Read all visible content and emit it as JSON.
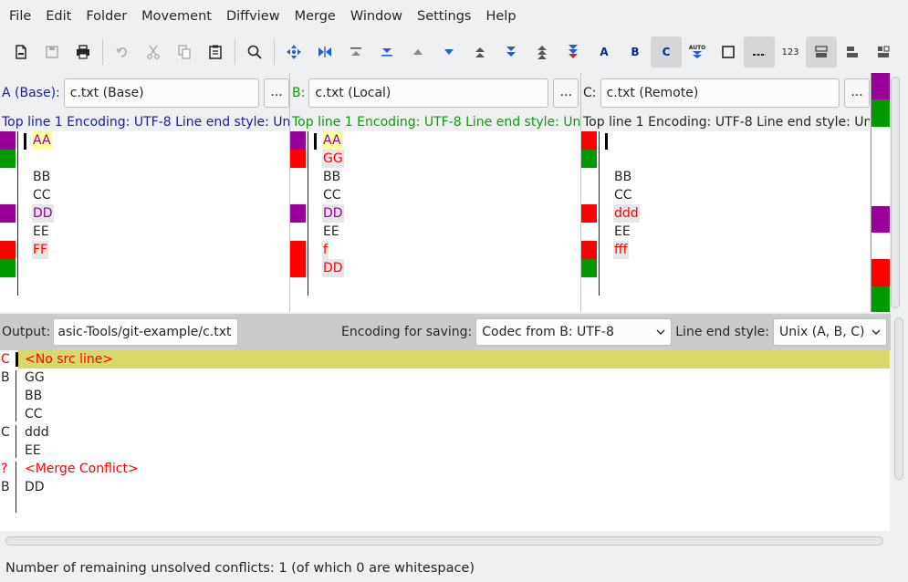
{
  "colors": {
    "base_label": "#1a1aa6",
    "local_label": "#0e9a0e",
    "remote_label": "#232627",
    "changed_purple": "#990099",
    "changed_red": "#ff0000",
    "added_green": "#009900",
    "merge_highlight": "#d9d96a"
  },
  "menu": [
    "File",
    "Edit",
    "Folder",
    "Movement",
    "Diffview",
    "Merge",
    "Window",
    "Settings",
    "Help"
  ],
  "toolbar": {
    "buttons": [
      "new-file",
      "save",
      "print",
      "undo",
      "cut",
      "copy",
      "paste",
      "find",
      "go-current",
      "go-top",
      "go-prev-delta",
      "go-bottom",
      "go-prev",
      "go-next",
      "go-prev-conflict",
      "go-next-conflict",
      "go-first-unsolved",
      "go-last-unsolved",
      "select-a",
      "select-b",
      "select-c",
      "auto-advance",
      "show-whitespace",
      "show-space-chars",
      "line-numbers",
      "split-view-1",
      "split-view-2",
      "split-view-3"
    ],
    "auto_label": "AUTO",
    "a_label": "A",
    "b_label": "B",
    "c_label": "C",
    "numbers_label": "123"
  },
  "panes": {
    "a": {
      "label": "A (Base):",
      "file": "c.txt (Base)",
      "browse": "...",
      "info": [
        "Top line 1",
        "Encoding: UTF-8",
        "Line end style: Uni"
      ],
      "lines": [
        {
          "text": "AA",
          "color": "#990099",
          "bg": "#ffffa0",
          "marker": "#990099"
        },
        {
          "text": "",
          "color": "",
          "bg": "",
          "marker": "#009900"
        },
        {
          "text": "BB",
          "color": "#232627",
          "bg": "",
          "marker": ""
        },
        {
          "text": "CC",
          "color": "#232627",
          "bg": "",
          "marker": ""
        },
        {
          "text": "DD",
          "color": "#990099",
          "bg": "#e6e6e6",
          "marker": "#990099"
        },
        {
          "text": "EE",
          "color": "#232627",
          "bg": "",
          "marker": ""
        },
        {
          "text": "FF",
          "color": "#ff0000",
          "bg": "#e6e6e6",
          "marker": "#ff0000"
        },
        {
          "text": "",
          "color": "",
          "bg": "",
          "marker": "#009900"
        }
      ]
    },
    "b": {
      "label": "B:",
      "file": "c.txt (Local)",
      "browse": "...",
      "info": [
        "Top line 1",
        "Encoding: UTF-8",
        "Line end style: Uni"
      ],
      "lines": [
        {
          "text": "AA",
          "color": "#990099",
          "bg": "#ffffa0",
          "marker": "#990099"
        },
        {
          "text": "GG",
          "color": "#ff0000",
          "bg": "#e6e6e6",
          "marker": "#ff0000"
        },
        {
          "text": "BB",
          "color": "#232627",
          "bg": "",
          "marker": ""
        },
        {
          "text": "CC",
          "color": "#232627",
          "bg": "",
          "marker": ""
        },
        {
          "text": "DD",
          "color": "#990099",
          "bg": "#e6e6e6",
          "marker": "#990099"
        },
        {
          "text": "EE",
          "color": "#232627",
          "bg": "",
          "marker": ""
        },
        {
          "text": "f",
          "color": "#ff0000",
          "bg": "#e6e6e6",
          "marker": "#ff0000"
        },
        {
          "text": "DD",
          "color": "#ff0000",
          "bg": "#e6e6e6",
          "marker": "#ff0000"
        }
      ]
    },
    "c": {
      "label": "C:",
      "file": "c.txt (Remote)",
      "browse": "...",
      "info": [
        "Top line 1",
        "Encoding: UTF-8",
        "Line end style: Uni"
      ],
      "lines": [
        {
          "text": "",
          "color": "",
          "bg": "",
          "marker": "#ff0000"
        },
        {
          "text": "",
          "color": "",
          "bg": "",
          "marker": "#009900"
        },
        {
          "text": "BB",
          "color": "#232627",
          "bg": "",
          "marker": ""
        },
        {
          "text": "CC",
          "color": "#232627",
          "bg": "",
          "marker": ""
        },
        {
          "text": "ddd",
          "color": "#ff0000",
          "bg": "#e6e6e6",
          "marker": "#ff0000"
        },
        {
          "text": "EE",
          "color": "#232627",
          "bg": "",
          "marker": ""
        },
        {
          "text": "fff",
          "color": "#ff0000",
          "bg": "#e6e6e6",
          "marker": "#ff0000"
        },
        {
          "text": "",
          "color": "",
          "bg": "",
          "marker": "#009900"
        }
      ]
    }
  },
  "overview": [
    "#990099",
    "#009900",
    "#ffffff",
    "#ffffff",
    "#990099",
    "#ffffff",
    "#ff0000",
    "#009900",
    "#ffffff"
  ],
  "output": {
    "label": "Output:",
    "path": "asic-Tools/git-example/c.txt",
    "encoding_label": "Encoding for saving:",
    "encoding_value": "Codec from B: UTF-8",
    "line_end_label": "Line end style:",
    "line_end_value": "Unix (A, B, C)",
    "lines": [
      {
        "src": "C",
        "src_color": "#ff0000",
        "text": "<No src line>",
        "color": "#ff0000",
        "highlight": true
      },
      {
        "src": "B",
        "src_color": "#232627",
        "text": "GG",
        "color": "#232627",
        "highlight": false
      },
      {
        "src": "",
        "src_color": "#232627",
        "text": "BB",
        "color": "#232627",
        "highlight": false
      },
      {
        "src": "",
        "src_color": "#232627",
        "text": "CC",
        "color": "#232627",
        "highlight": false
      },
      {
        "src": "C",
        "src_color": "#232627",
        "text": "ddd",
        "color": "#232627",
        "highlight": false
      },
      {
        "src": "",
        "src_color": "#232627",
        "text": "EE",
        "color": "#232627",
        "highlight": false
      },
      {
        "src": "?",
        "src_color": "#ff0000",
        "text": "<Merge Conflict>",
        "color": "#ff0000",
        "highlight": false
      },
      {
        "src": "B",
        "src_color": "#232627",
        "text": "DD",
        "color": "#232627",
        "highlight": false
      }
    ]
  },
  "status": "Number of remaining unsolved conflicts: 1 (of which 0 are whitespace)"
}
